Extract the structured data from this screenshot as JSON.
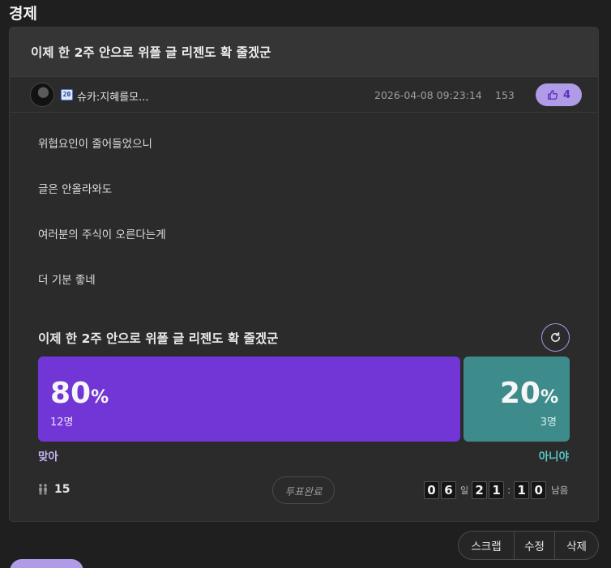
{
  "board": {
    "title": "경제"
  },
  "post": {
    "title": "이제 한 2주 안으로 위폴 글 리젠도 확 줄겠군",
    "author": {
      "level": "20",
      "name": "슈카:지혜를모..."
    },
    "date": "2026-04-08 09:23:14",
    "views": "153",
    "likes": "4",
    "body": [
      "위협요인이 줄어들었으니",
      "글은 안올라와도",
      "여러분의 주식이 오른다는게",
      "더 기분 좋네"
    ]
  },
  "poll": {
    "title": "이제 한 2주 안으로 위폴 글 리젠도 확 줄겠군",
    "options": [
      {
        "label": "맞아",
        "percent": "80",
        "count": "12명",
        "color": "#7235d6"
      },
      {
        "label": "아니야",
        "percent": "20",
        "count": "3명",
        "color": "#3d8b8b"
      }
    ],
    "percent_symbol": "%",
    "voters": "15",
    "status": "투표완료",
    "timer": {
      "days": [
        "0",
        "6"
      ],
      "days_unit": "일",
      "hours": [
        "2",
        "1"
      ],
      "separator": ":",
      "minutes": [
        "1",
        "0"
      ],
      "remaining_label": "남음"
    }
  },
  "actions": {
    "scrap": "스크랩",
    "edit": "수정",
    "delete": "삭제"
  },
  "colors": {
    "accent": "#b09be6",
    "yes": "#7235d6",
    "no": "#3d8b8b"
  }
}
